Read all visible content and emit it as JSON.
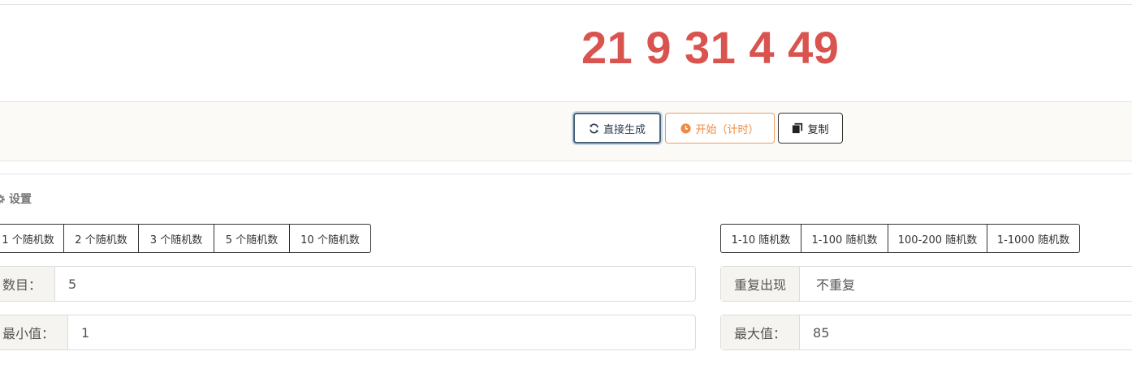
{
  "result": {
    "numbers": "21 9 31 4 49"
  },
  "toolbar": {
    "generate_label": "直接生成",
    "start_label": "开始（计时）",
    "copy_label": "复制"
  },
  "settings": {
    "title": "设置",
    "count_presets": [
      "1 个随机数",
      "2 个随机数",
      "3 个随机数",
      "5 个随机数",
      "10 个随机数"
    ],
    "range_presets": [
      "1-10 随机数",
      "1-100 随机数",
      "100-200 随机数",
      "1-1000 随机数"
    ],
    "count_label": "数目：",
    "count_value": "5",
    "repeat_label": "重复出现",
    "repeat_value": "不重复",
    "min_label": "最小值：",
    "min_value": "1",
    "max_label": "最大值：",
    "max_value": "85"
  },
  "colors": {
    "result": "#d9534f",
    "start_accent": "#ee8a42",
    "generate_border": "#4a6177"
  },
  "icons": {
    "generate": "refresh-icon",
    "start": "clock-icon",
    "copy": "copy-icon",
    "settings": "gear-icon"
  }
}
